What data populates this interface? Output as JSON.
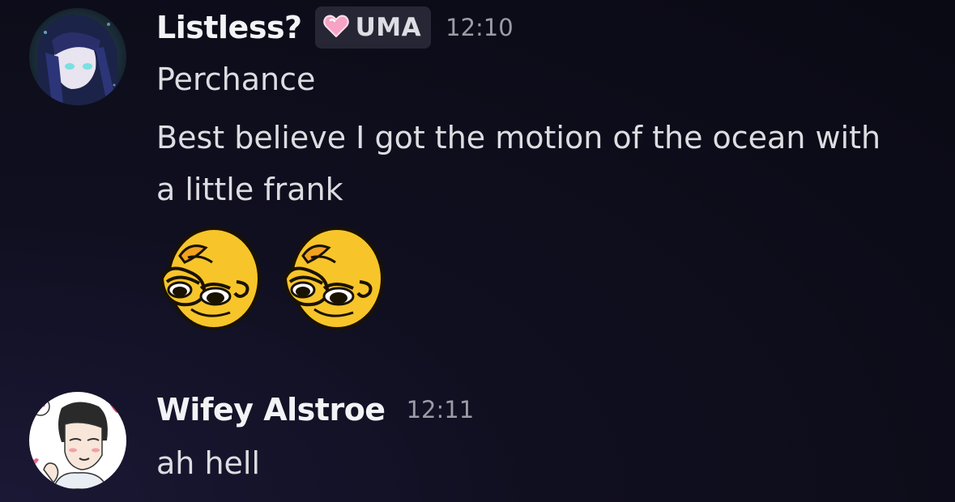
{
  "messages": [
    {
      "username": "Listless?",
      "tag": {
        "icon": "pink-heart-icon",
        "label": "UMA"
      },
      "timestamp": "12:10",
      "lines": [
        "Perchance",
        "Best believe I got the motion of the ocean with",
        "a little frank"
      ],
      "emojis": [
        "smug-duck-emoji",
        "smug-duck-emoji"
      ]
    },
    {
      "username": "Wifey Alstroe",
      "timestamp": "12:11",
      "lines": [
        "ah hell"
      ]
    }
  ],
  "colors": {
    "background": "#0c0b18",
    "username": "#f2f3f5",
    "text": "#dbdee1",
    "timestamp": "#9a9ca6",
    "tag_bg": "#272635",
    "heart": "#f6a3c5"
  }
}
